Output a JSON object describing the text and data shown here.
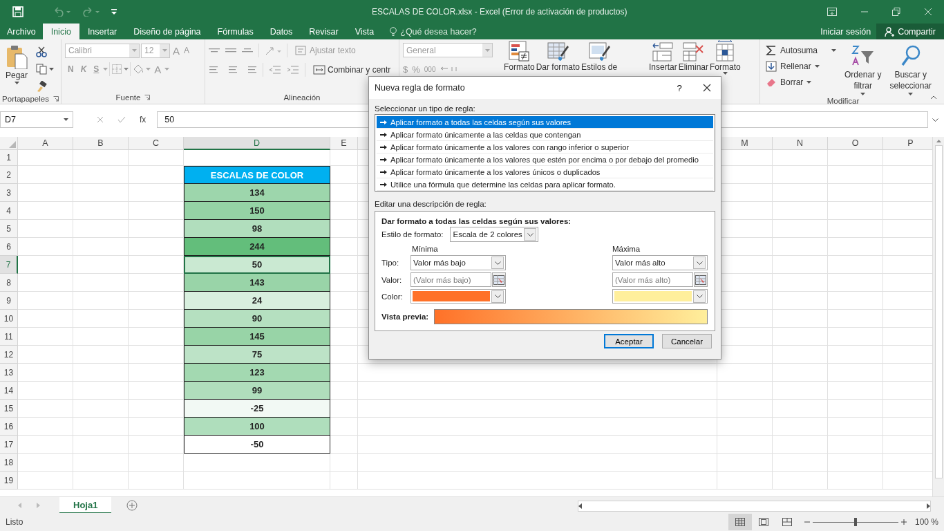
{
  "window": {
    "title": "ESCALAS DE COLOR.xlsx - Excel (Error de activación de productos)"
  },
  "tabs": [
    {
      "label": "Archivo",
      "selected": false,
      "kind": "file"
    },
    {
      "label": "Inicio",
      "selected": true,
      "kind": "tab"
    },
    {
      "label": "Insertar",
      "selected": false,
      "kind": "tab"
    },
    {
      "label": "Diseño de página",
      "selected": false,
      "kind": "tab"
    },
    {
      "label": "Fórmulas",
      "selected": false,
      "kind": "tab"
    },
    {
      "label": "Datos",
      "selected": false,
      "kind": "tab"
    },
    {
      "label": "Revisar",
      "selected": false,
      "kind": "tab"
    },
    {
      "label": "Vista",
      "selected": false,
      "kind": "tab"
    }
  ],
  "tell_me": {
    "placeholder": "¿Qué desea hacer?"
  },
  "account": {
    "sign_in": "Iniciar sesión",
    "share": "Compartir"
  },
  "ribbon": {
    "groups": [
      {
        "kind": "clipboard",
        "label": "Portapapeles",
        "paste": "Pegar",
        "disabled": false
      },
      {
        "kind": "font",
        "label": "Fuente",
        "font": "Calibri",
        "size": "12",
        "size_buttons": [
          "A",
          "A"
        ],
        "styles": [
          "N",
          "K",
          "S"
        ],
        "font_color": "A",
        "disabled": true
      },
      {
        "kind": "alignment",
        "label": "Alineación",
        "wrap": "Ajustar texto",
        "merge": "Combinar y centr",
        "disabled": true
      },
      {
        "kind": "number",
        "format": "General",
        "symbols": [
          "$",
          "%",
          "000"
        ],
        "disabled": true
      },
      {
        "kind": "styles",
        "buttons": [
          "Formato",
          "Dar formato",
          "Estilos de"
        ],
        "disabled": false
      },
      {
        "kind": "cells",
        "buttons": [
          "Insertar",
          "Eliminar",
          "Formato"
        ],
        "disabled": false
      },
      {
        "kind": "editing",
        "label": "Modificar",
        "small": [
          "Autosuma",
          "Rellenar",
          "Borrar"
        ],
        "big": [
          "Ordenar y\nfiltrar",
          "Buscar y\nseleccionar"
        ],
        "disabled": false
      }
    ]
  },
  "formula_bar": {
    "name_box": "D7",
    "fx": "fx",
    "value": "50"
  },
  "sheet": {
    "columns": [
      {
        "letter": "A",
        "selected": false
      },
      {
        "letter": "B",
        "selected": false
      },
      {
        "letter": "C",
        "selected": false
      },
      {
        "letter": "D",
        "selected": true
      },
      {
        "letter": "E",
        "selected": false
      }
    ],
    "columns_right": [
      {
        "letter": "M",
        "selected": false
      },
      {
        "letter": "N",
        "selected": false
      },
      {
        "letter": "O",
        "selected": false
      },
      {
        "letter": "P",
        "selected": false
      }
    ],
    "rows": [
      {
        "number": "1",
        "selected": false
      },
      {
        "number": "2",
        "selected": false,
        "d": {
          "kind": "header",
          "value": "ESCALAS DE COLOR",
          "color": "#00b0f0",
          "selected": false
        }
      },
      {
        "number": "3",
        "selected": false,
        "d": {
          "kind": "value",
          "value": "134",
          "color": "#9dd6ac",
          "selected": false
        }
      },
      {
        "number": "4",
        "selected": false,
        "d": {
          "kind": "value",
          "value": "150",
          "color": "#95d3a5",
          "selected": false
        }
      },
      {
        "number": "5",
        "selected": false,
        "d": {
          "kind": "value",
          "value": "98",
          "color": "#b1debd",
          "selected": false
        }
      },
      {
        "number": "6",
        "selected": false,
        "d": {
          "kind": "value",
          "value": "244",
          "color": "#63be7b",
          "selected": false
        }
      },
      {
        "number": "7",
        "selected": true,
        "d": {
          "kind": "value",
          "value": "50",
          "color": "#cae9d2",
          "selected": true
        }
      },
      {
        "number": "8",
        "selected": false,
        "d": {
          "kind": "value",
          "value": "143",
          "color": "#99d4a8",
          "selected": false
        }
      },
      {
        "number": "9",
        "selected": false,
        "d": {
          "kind": "value",
          "value": "24",
          "color": "#d8efde",
          "selected": false
        }
      },
      {
        "number": "10",
        "selected": false,
        "d": {
          "kind": "value",
          "value": "90",
          "color": "#b5e0c0",
          "selected": false
        }
      },
      {
        "number": "11",
        "selected": false,
        "d": {
          "kind": "value",
          "value": "145",
          "color": "#98d4a7",
          "selected": false
        }
      },
      {
        "number": "12",
        "selected": false,
        "d": {
          "kind": "value",
          "value": "75",
          "color": "#bde3c7",
          "selected": false
        }
      },
      {
        "number": "13",
        "selected": false,
        "d": {
          "kind": "value",
          "value": "123",
          "color": "#a3d9b1",
          "selected": false
        }
      },
      {
        "number": "14",
        "selected": false,
        "d": {
          "kind": "value",
          "value": "99",
          "color": "#b0debc",
          "selected": false
        }
      },
      {
        "number": "15",
        "selected": false,
        "d": {
          "kind": "value",
          "value": "-25",
          "color": "#f2f9f4",
          "selected": false
        }
      },
      {
        "number": "16",
        "selected": false,
        "d": {
          "kind": "value",
          "value": "100",
          "color": "#afdebc",
          "selected": false
        }
      },
      {
        "number": "17",
        "selected": false,
        "d": {
          "kind": "value",
          "value": "-50",
          "color": "#ffffff",
          "selected": false
        }
      },
      {
        "number": "18",
        "selected": false
      },
      {
        "number": "19",
        "selected": false
      }
    ]
  },
  "sheet_tabs": [
    {
      "label": "Hoja1",
      "selected": true
    }
  ],
  "status_bar": {
    "text": "Listo",
    "zoom": "100 %",
    "level": 0.5
  },
  "dialog": {
    "title": "Nueva regla de formato",
    "help": "?",
    "rule_type_label": "Seleccionar un tipo de regla:",
    "rule_types": [
      {
        "label": "Aplicar formato a todas las celdas según sus valores",
        "selected": true
      },
      {
        "label": "Aplicar formato únicamente a las celdas que contengan",
        "selected": false
      },
      {
        "label": "Aplicar formato únicamente a los valores con rango inferior o superior",
        "selected": false
      },
      {
        "label": "Aplicar formato únicamente a los valores que estén por encima o por debajo del promedio",
        "selected": false
      },
      {
        "label": "Aplicar formato únicamente a los valores únicos o duplicados",
        "selected": false
      },
      {
        "label": "Utilice una fórmula que determine las celdas para aplicar formato.",
        "selected": false
      }
    ],
    "description_label": "Editar una descripción de regla:",
    "heading": "Dar formato a todas las celdas según sus valores:",
    "style_label": "Estilo de formato:",
    "style_value": "Escala de 2 colores",
    "row_labels": [
      "Tipo:",
      "Valor:",
      "Color:"
    ],
    "minimum": {
      "title": "Mínima",
      "type": "Valor más bajo",
      "value_placeholder": "(Valor más bajo)",
      "color": "#ff7128"
    },
    "maximum": {
      "title": "Máxima",
      "type": "Valor más alto",
      "value_placeholder": "(Valor más alto)",
      "color": "#ffef9c"
    },
    "preview_label": "Vista previa:",
    "buttons": [
      {
        "label": "Aceptar",
        "kind": "default"
      },
      {
        "label": "Cancelar",
        "kind": "normal"
      }
    ]
  }
}
